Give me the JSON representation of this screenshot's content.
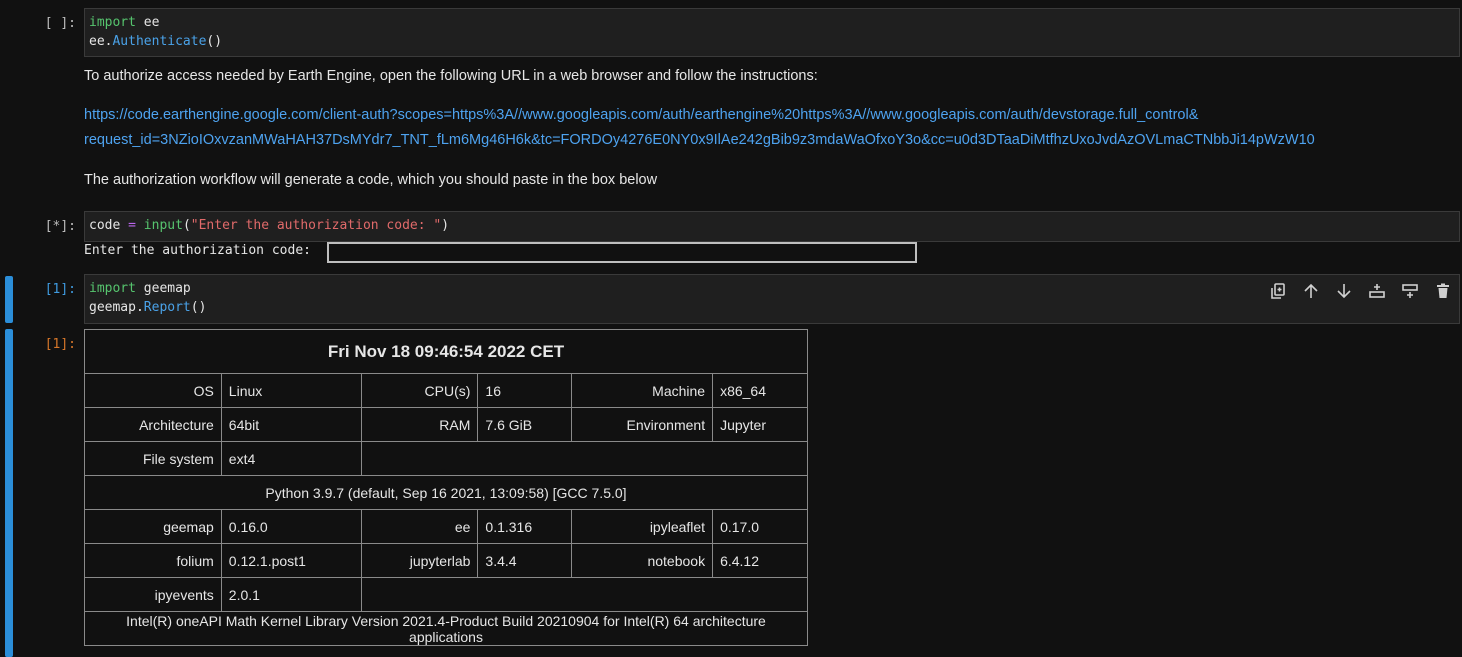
{
  "cells": [
    {
      "prompt": "[ ]:",
      "lines": [
        [
          {
            "t": "import",
            "c": "kw"
          },
          {
            "t": " ee",
            "c": ""
          }
        ],
        [
          {
            "t": "ee.",
            "c": ""
          },
          {
            "t": "Authenticate",
            "c": "fn"
          },
          {
            "t": "()",
            "c": ""
          }
        ]
      ]
    },
    {
      "prompt": "[*]:",
      "lines": [
        [
          {
            "t": "code ",
            "c": ""
          },
          {
            "t": "=",
            "c": "op"
          },
          {
            "t": " ",
            "c": ""
          },
          {
            "t": "input",
            "c": "kw"
          },
          {
            "t": "(",
            "c": ""
          },
          {
            "t": "\"Enter the authorization code: \"",
            "c": "str"
          },
          {
            "t": ")",
            "c": ""
          }
        ]
      ]
    },
    {
      "prompt": "[1]:",
      "lines": [
        [
          {
            "t": "import",
            "c": "kw"
          },
          {
            "t": " geemap",
            "c": ""
          }
        ],
        [
          {
            "t": "geemap.",
            "c": ""
          },
          {
            "t": "Report",
            "c": "fn"
          },
          {
            "t": "()",
            "c": ""
          }
        ]
      ]
    }
  ],
  "auth": {
    "intro": "To authorize access needed by Earth Engine, open the following URL in a web browser and follow the instructions:",
    "url_line1": "https://code.earthengine.google.com/client-auth?scopes=https%3A//www.googleapis.com/auth/earthengine%20https%3A//www.googleapis.com/auth/devstorage.full_control&",
    "url_line2": "request_id=3NZioIOxvzanMWaHAH37DsMYdr7_TNT_fLm6Mg46H6k&tc=FORDOy4276E0NY0x9IlAe242gBib9z3mdaWaOfxoY3o&cc=u0d3DTaaDiMtfhzUxoJvdAzOVLmaCTNbbJi14pWzW10",
    "outro": "The authorization workflow will generate a code, which you should paste in the box below"
  },
  "input_prompt": {
    "label": "Enter the authorization code:",
    "value": ""
  },
  "output": {
    "prompt": "[1]:",
    "report": {
      "title": "Fri Nov 18 09:46:54 2022 CET",
      "row1": [
        [
          "OS",
          "Linux"
        ],
        [
          "CPU(s)",
          "16"
        ],
        [
          "Machine",
          "x86_64"
        ]
      ],
      "row2": [
        [
          "Architecture",
          "64bit"
        ],
        [
          "RAM",
          "7.6 GiB"
        ],
        [
          "Environment",
          "Jupyter"
        ]
      ],
      "row3": [
        [
          "File system",
          "ext4"
        ]
      ],
      "python": "Python 3.9.7 (default, Sep 16 2021, 13:09:58) [GCC 7.5.0]",
      "row5": [
        [
          "geemap",
          "0.16.0"
        ],
        [
          "ee",
          "0.1.316"
        ],
        [
          "ipyleaflet",
          "0.17.0"
        ]
      ],
      "row6": [
        [
          "folium",
          "0.12.1.post1"
        ],
        [
          "jupyterlab",
          "3.4.4"
        ],
        [
          "notebook",
          "6.4.12"
        ]
      ],
      "row7": [
        [
          "ipyevents",
          "2.0.1"
        ]
      ],
      "mkl": "Intel(R) oneAPI Math Kernel Library Version 2021.4-Product Build 20210904 for Intel(R) 64 architecture applications"
    }
  },
  "toolbar_icons": [
    "duplicate-icon",
    "move-up-icon",
    "move-down-icon",
    "insert-above-icon",
    "insert-below-icon",
    "delete-icon"
  ]
}
